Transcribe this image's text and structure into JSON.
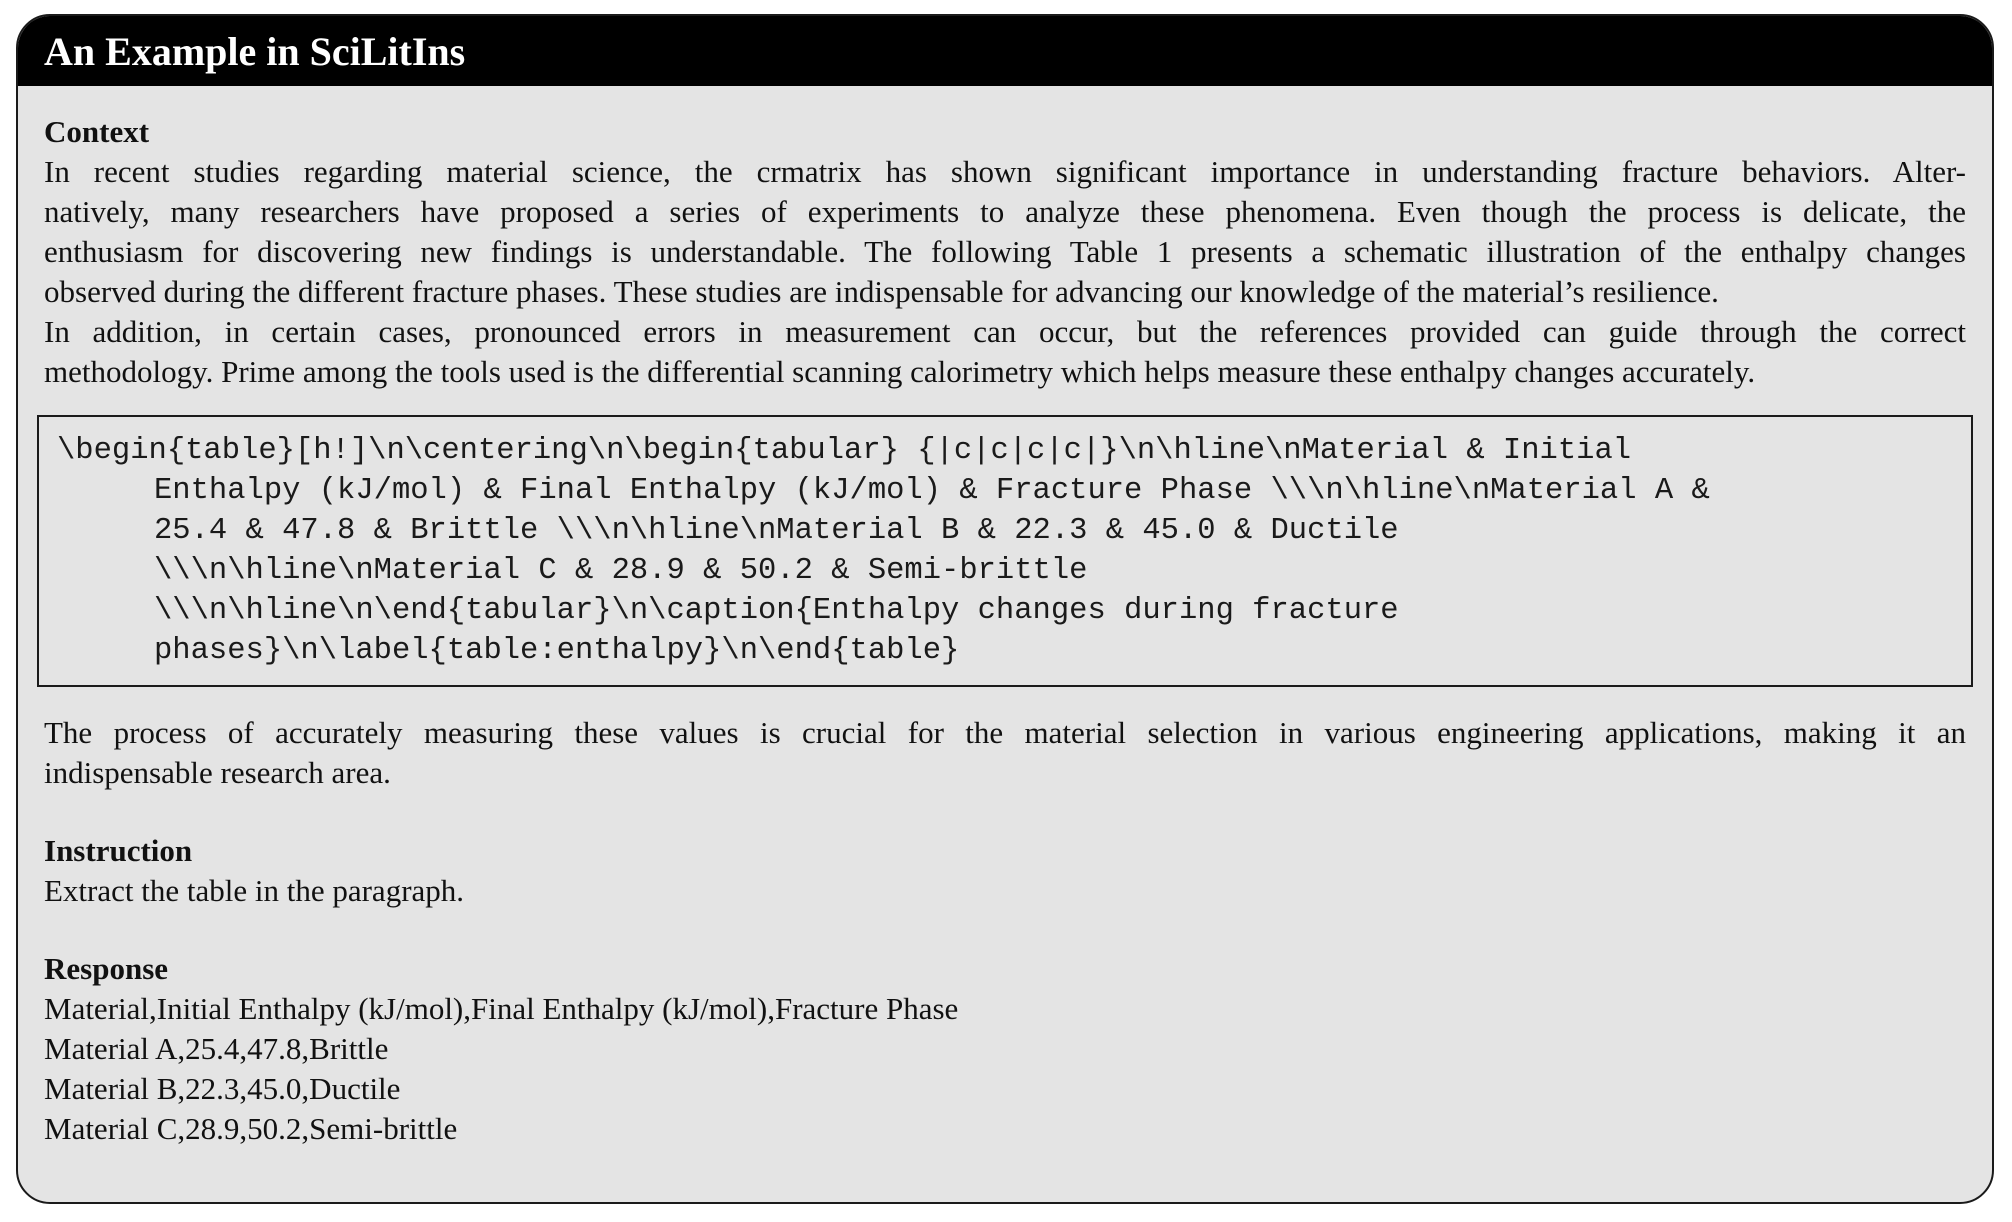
{
  "title": "An Example in SciLitIns",
  "context": {
    "heading": "Context",
    "paragraph1_lines": [
      "In recent studies regarding material science, the crmatrix has shown significant importance in understanding fracture behaviors. Alter-",
      "natively, many researchers have proposed a series of experiments to analyze these phenomena. Even though the process is delicate, the",
      "enthusiasm for discovering new findings is understandable. The following Table 1 presents a schematic illustration of the enthalpy changes",
      "observed during the different fracture phases. These studies are indispensable for advancing our knowledge of the material’s resilience."
    ],
    "paragraph2_lines": [
      "In addition, in certain cases, pronounced errors in measurement can occur, but the references provided can guide through the correct",
      "methodology. Prime among the tools used is the differential scanning calorimetry which helps measure these enthalpy changes accurately."
    ],
    "code_lines": [
      "\\begin{table}[h!]\\n\\centering\\n\\begin{tabular} {|c|c|c|c|}\\n\\hline\\nMaterial & Initial",
      "Enthalpy (kJ/mol) & Final Enthalpy (kJ/mol) & Fracture Phase \\\\\\n\\hline\\nMaterial A &",
      "25.4 & 47.8 & Brittle \\\\\\n\\hline\\nMaterial B & 22.3 & 45.0 & Ductile",
      "\\\\\\n\\hline\\nMaterial C & 28.9 & 50.2 & Semi-brittle",
      "\\\\\\n\\hline\\n\\end{tabular}\\n\\caption{Enthalpy changes during fracture",
      "phases}\\n\\label{table:enthalpy}\\n\\end{table}"
    ],
    "paragraph3_lines": [
      "The process of accurately measuring these values is crucial for the material selection in various engineering applications, making it an",
      "indispensable research area."
    ]
  },
  "instruction": {
    "heading": "Instruction",
    "text": "Extract the table in the paragraph."
  },
  "response": {
    "heading": "Response",
    "lines": [
      "Material,Initial Enthalpy (kJ/mol),Final Enthalpy (kJ/mol),Fracture Phase",
      "Material A,25.4,47.8,Brittle",
      "Material B,22.3,45.0,Ductile",
      "Material C,28.9,50.2,Semi-brittle"
    ]
  }
}
